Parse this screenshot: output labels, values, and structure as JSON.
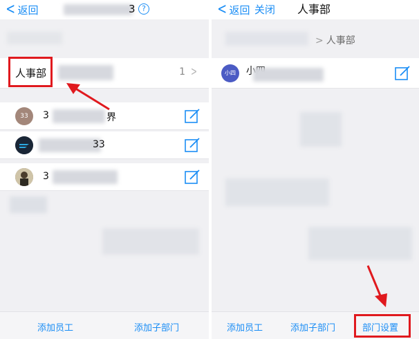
{
  "left_screen": {
    "back_label": "返回",
    "title_suffix": "3",
    "help_icon": "?",
    "department": {
      "label": "人事部",
      "count": "1"
    },
    "members": [
      {
        "avatar_text": "33",
        "name": "3",
        "name_suffix": "界"
      },
      {
        "avatar_text": "",
        "name": "",
        "name_suffix": "33"
      },
      {
        "avatar_text": "",
        "name": "3",
        "name_suffix": ""
      }
    ],
    "bottom": {
      "add_employee": "添加员工",
      "add_sub_department": "添加子部门"
    }
  },
  "right_screen": {
    "back_label": "返回",
    "close_label": "关闭",
    "title": "人事部",
    "breadcrumb_current": "人事部",
    "member": {
      "avatar_text": "小四",
      "name": "小四"
    },
    "bottom": {
      "add_employee": "添加员工",
      "add_sub_department": "添加子部门",
      "department_settings": "部门设置"
    }
  },
  "colors": {
    "accent": "#1a8df5",
    "highlight": "#e0191e",
    "background": "#f0f0f3"
  }
}
